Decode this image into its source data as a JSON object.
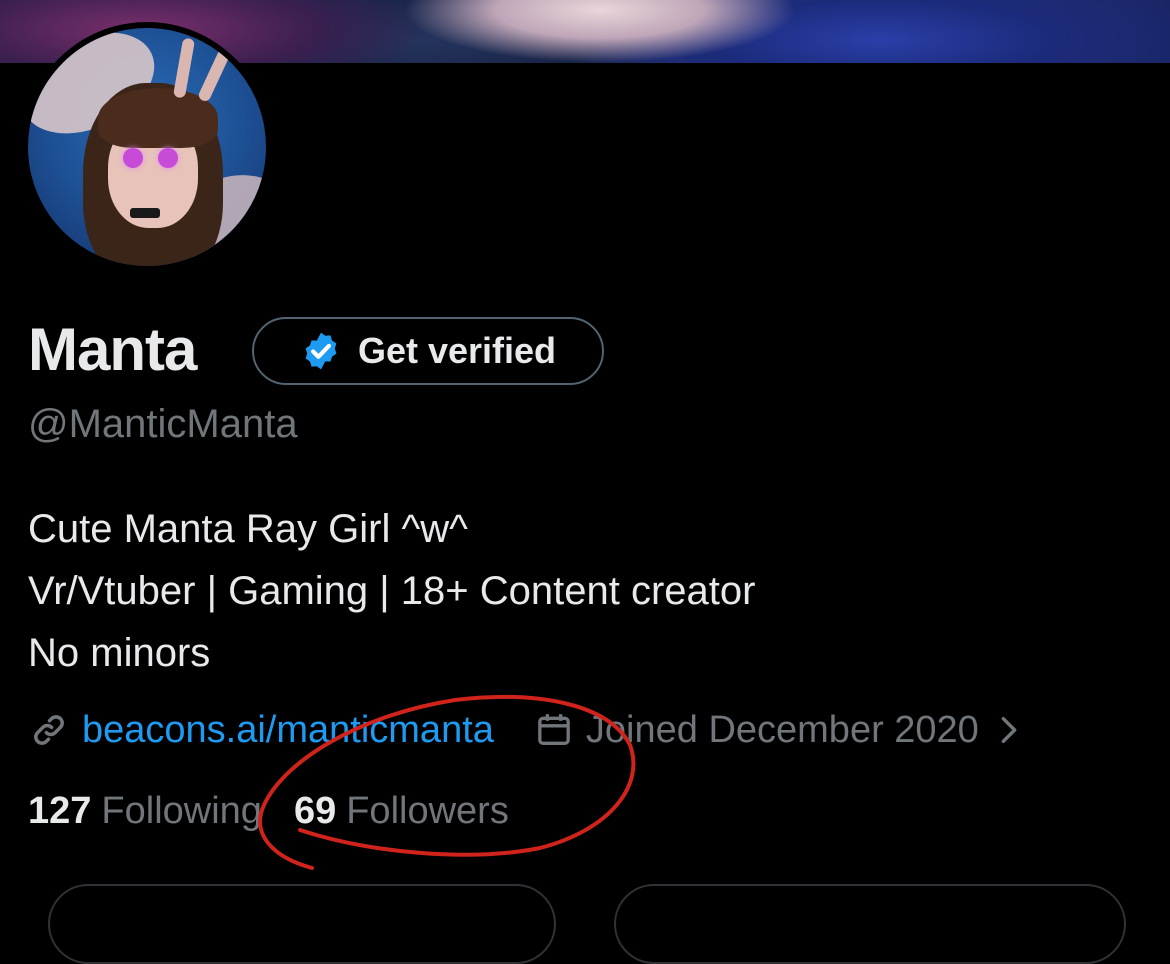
{
  "profile": {
    "display_name": "Manta",
    "handle": "@ManticManta",
    "bio_lines": [
      "Cute Manta Ray Girl ^w^",
      "Vr/Vtuber | Gaming | 18+ Content creator",
      "No minors"
    ],
    "link": "beacons.ai/manticmanta",
    "joined": "Joined December 2020"
  },
  "verify_button": {
    "label": "Get verified"
  },
  "stats": {
    "following_count": "127",
    "following_label": "Following",
    "followers_count": "69",
    "followers_label": "Followers"
  },
  "colors": {
    "background": "#000000",
    "text_primary": "#e7e9ea",
    "text_secondary": "#71767b",
    "link": "#1d9bf0",
    "verified_badge": "#1d9bf0",
    "annotation": "#d0231b"
  },
  "icons": [
    "link-icon",
    "calendar-icon",
    "chevron-right-icon",
    "verified-badge-icon"
  ]
}
